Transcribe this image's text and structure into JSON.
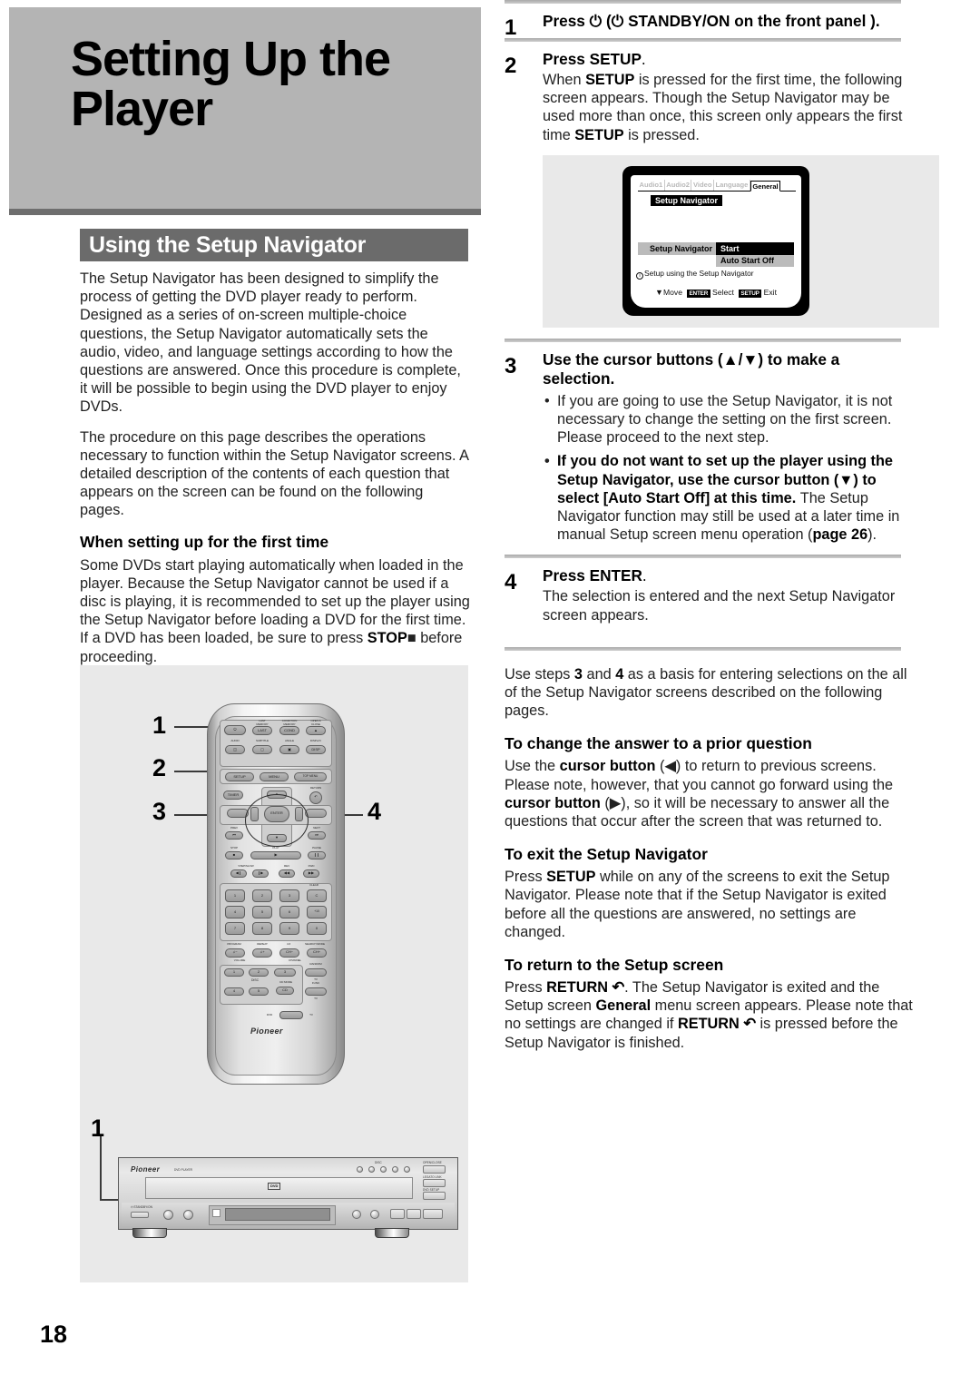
{
  "page": {
    "number": "18"
  },
  "left": {
    "chapter_title_line1": "Setting Up the",
    "chapter_title_line2": "Player",
    "section_bar": "Using the Setup Navigator",
    "paragraph1": "The Setup Navigator has been designed to simplify the process of getting the DVD player ready to perform. Designed as a series of on-screen multiple-choice questions, the Setup Navigator automatically sets the audio, video, and language settings according to how the questions are answered. Once this procedure is complete, it will be possible to begin using the DVD player to enjoy DVDs.",
    "paragraph2": "The procedure on this page describes the operations necessary to function within the Setup Navigator screens. A detailed description of the contents of each question that appears on the screen can be found on the following pages.",
    "subheading": "When setting up for the first time",
    "paragraph3_part1": "Some DVDs start playing automatically when loaded in the player. Because the Setup Navigator cannot be used if a disc is playing, it is recommended to set up the player using the Setup Navigator before loading a DVD for the first time. If a DVD has been loaded, be sure to press ",
    "paragraph3_bold": "STOP",
    "paragraph3_glyph": "■",
    "paragraph3_part2": " before proceeding.",
    "callouts": {
      "remote_1": "1",
      "remote_2": "2",
      "remote_3": "3",
      "remote_4": "4",
      "player_1": "1"
    },
    "remote": {
      "brand": "Pioneer",
      "keys": [
        {
          "label": "",
          "glyph": "⏻"
        },
        {
          "label": "LAST MEMORY",
          "glyph": "LAST"
        },
        {
          "label": "CONDITION MEMORY",
          "glyph": "COND"
        },
        {
          "label": "OPEN & CLOSE",
          "glyph": "▲"
        },
        {
          "label": "AUDIO",
          "glyph": "□)))"
        },
        {
          "label": "SUBTITLE",
          "glyph": "□"
        },
        {
          "label": "ANGLE",
          "glyph": "□"
        },
        {
          "label": "DISPLAY",
          "glyph": "DISP"
        },
        {
          "label": "",
          "glyph": "SETUP"
        },
        {
          "label": "",
          "glyph": "MENU"
        },
        {
          "label": "",
          "glyph": "TOP MENU"
        },
        {
          "label": "",
          "glyph": "TIMER"
        },
        {
          "label": "RETURN",
          "glyph": "↶"
        },
        {
          "label": "",
          "glyph": "ENTER"
        },
        {
          "label": "PREV",
          "glyph": "⏮"
        },
        {
          "label": "NEXT",
          "glyph": "⏭"
        },
        {
          "label": "STOP",
          "glyph": "■"
        },
        {
          "label": "PLAY",
          "glyph": "▶"
        },
        {
          "label": "PAUSE",
          "glyph": "❙❙"
        },
        {
          "label": "STEP/SLOW",
          "glyph": "◀❙"
        },
        {
          "label": "STEP/SLOW",
          "glyph": "❙▶"
        },
        {
          "label": "REV",
          "glyph": "◀◀"
        },
        {
          "label": "FWD",
          "glyph": "▶▶"
        }
      ],
      "numpad": [
        "1",
        "2",
        "3",
        "C",
        "4",
        "5",
        "6",
        "+10",
        "7",
        "8",
        "9",
        "0"
      ],
      "numpad_clear": "CLEAR",
      "row_labels": [
        "PROGRAM",
        "REPEAT",
        "4:3",
        "SEARCH MODE"
      ],
      "volume_label": "VOLUME",
      "channel_label": "CHANNEL",
      "disc_label": "DISC",
      "disc_buttons": [
        "1",
        "2",
        "3",
        "4",
        "5"
      ],
      "cd_mode": "CD MODE",
      "random": "RANDOM",
      "tv_func": "TV FUNC",
      "tv": "TV",
      "switch_left": "DVD",
      "switch_right": "TV"
    },
    "player": {
      "brand": "Pioneer",
      "model": "DVD PLAYER",
      "standby_label": "STANDBY/ON",
      "disc_badge": "DVD",
      "disc_badge_sub": "VIDEO",
      "disc_label": "DISC",
      "open_close": "OPEN/CLOSE",
      "legato": "LEGATO LINK",
      "dvd_setup": "DVD SETUP"
    }
  },
  "right": {
    "steps": [
      {
        "num": "1",
        "head_pre": "Press ",
        "head_glyph": "⏻",
        "head_post": " (⏻ STANDBY/ON on the front panel ).",
        "text": ""
      },
      {
        "num": "2",
        "head": "Press SETUP.",
        "head_bold": "Press SETUP",
        "head_tail": ".",
        "text_p1": "When ",
        "text_b1": "SETUP",
        "text_p2": " is pressed for the first time, the following screen appears. Though the Setup Navigator may be used more than once, this screen only appears the first time ",
        "text_b2": "SETUP",
        "text_p3": " is pressed."
      },
      {
        "num": "3",
        "head": "Use the cursor buttons (▲/▼) to make a selection.",
        "bullet1": "If you are going to use the Setup Navigator, it is not necessary to change the setting on the first screen. Please proceed to the next step.",
        "bullet2_bold": "If you do not want to set up the player using the Setup Navigator, use the cursor button (▼) to select [Auto Start Off] at this time.",
        "bullet2_normal_pre": "The Setup Navigator function may still be used at a later time in manual Setup screen menu operation (",
        "bullet2_page": "page 26",
        "bullet2_normal_post": ")."
      },
      {
        "num": "4",
        "head": "Press ENTER.",
        "head_bold": "Press ENTER",
        "head_tail": ".",
        "text": "The selection is entered and the next Setup Navigator screen appears."
      }
    ],
    "summary_pre": "Use steps ",
    "summary_b1": "3",
    "summary_mid": " and ",
    "summary_b2": "4",
    "summary_post": " as a basis for entering selections on the all of the Setup Navigator screens described on the following pages.",
    "sections": [
      {
        "heading": "To change the answer to a prior question",
        "p_pre": "Use the ",
        "p_b1": "cursor button",
        "p_m1": " (◀) to return to previous screens. Please note, however, that you cannot go forward using the ",
        "p_b2": "cursor button",
        "p_m2": " (▶), so it will be necessary to answer all the questions that occur after the screen that was returned to."
      },
      {
        "heading": "To exit the Setup Navigator",
        "p_pre": "Press ",
        "p_b1": "SETUP",
        "p_m1": " while on any of the screens to exit the Setup Navigator. Please note that if the Setup Navigator is exited before all the questions are answered, no settings are changed."
      },
      {
        "heading": "To return to the Setup screen",
        "p_pre": "Press ",
        "p_b1": "RETURN ↶",
        "p_m1": ". The Setup Navigator is exited and the Setup screen ",
        "p_b2": "General",
        "p_m2": " menu screen appears. Please note that no settings are changed if ",
        "p_b3": "RETURN ↶",
        "p_m3": " is pressed before the Setup Navigator is finished."
      }
    ],
    "osd": {
      "tabs": [
        "Audio1",
        "Audio2",
        "Video",
        "Language",
        "General"
      ],
      "active_tab": "General",
      "title": "Setup Navigator",
      "row_label": "Setup Navigator",
      "option_selected": "Start",
      "option_other": "Auto Start Off",
      "hint_marker": "i",
      "hint": "Setup using the Setup Navigator",
      "foot_move_glyph": "▼",
      "foot_move": "Move",
      "foot_enter_key": "ENTER",
      "foot_enter": "Select",
      "foot_setup_key": "SETUP",
      "foot_setup": "Exit"
    }
  }
}
